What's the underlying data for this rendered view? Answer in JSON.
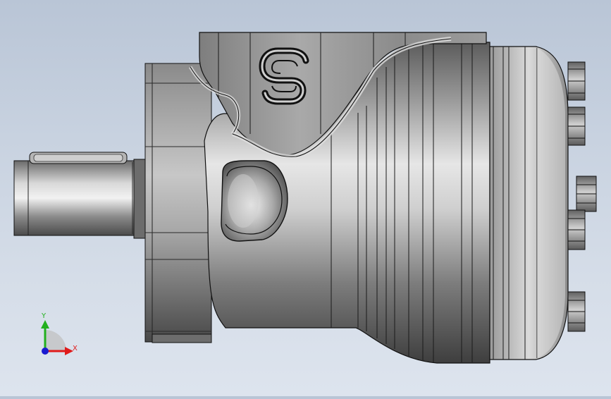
{
  "viewport": {
    "background_top": "#b9c5d6",
    "background_bottom": "#dde4ee"
  },
  "model": {
    "logo_icon": "s-logo-icon",
    "body_color": "#8e8e8e",
    "highlight_color": "#e8e8e8",
    "edge_color": "#111111"
  },
  "triad": {
    "x_label": "X",
    "y_label": "Y",
    "x_color": "#e01b1b",
    "y_color": "#22b01e",
    "z_color": "#1a1ad0"
  }
}
